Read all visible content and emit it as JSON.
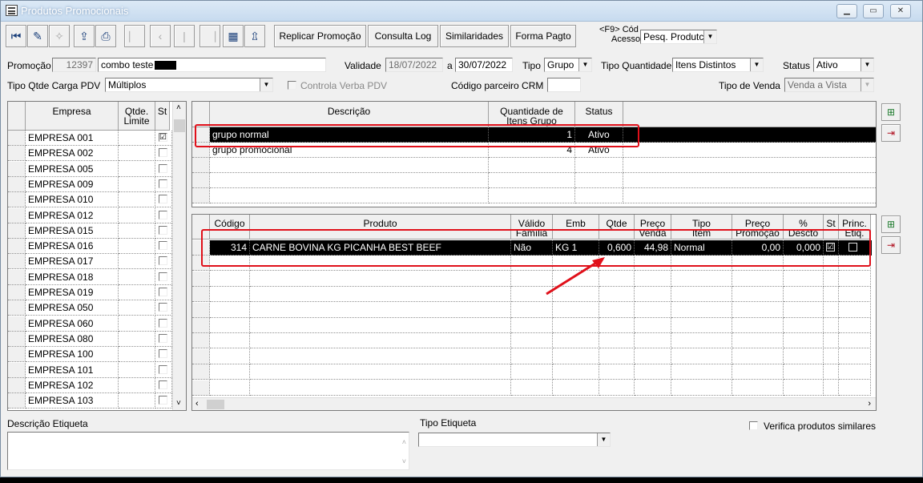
{
  "window": {
    "title": "Produtos Promocionais"
  },
  "toolbar": {
    "replicar": "Replicar Promoção",
    "consulta_log": "Consulta Log",
    "similaridades": "Similaridades",
    "forma_pagto": "Forma Pagto",
    "f9_label_1": "<F9> Cód",
    "f9_label_2": "Acesso",
    "pesq_value": "Pesq. Produtc"
  },
  "form": {
    "promocao_label": "Promoção",
    "promocao_code": "12397",
    "promocao_name": "combo teste",
    "validade_label": "Validade",
    "validade_from": "18/07/2022",
    "validade_a": "a",
    "validade_to": "30/07/2022",
    "tipo_label": "Tipo",
    "tipo_value": "Grupo",
    "tipo_qtd_label": "Tipo Quantidade",
    "tipo_qtd_value": "Itens Distintos",
    "status_label": "Status",
    "status_value": "Ativo",
    "carga_label": "Tipo Qtde Carga PDV",
    "carga_value": "Múltiplos",
    "controla_label": "Controla Verba PDV",
    "crm_label": "Código parceiro CRM",
    "crm_value": "",
    "venda_label": "Tipo de Venda",
    "venda_value": "Venda a Vista"
  },
  "empresas": {
    "headers": {
      "empresa": "Empresa",
      "qtde1": "Qtde.",
      "qtde2": "Limite",
      "st": "St"
    },
    "rows": [
      {
        "name": "EMPRESA 001",
        "checked": "☑"
      },
      {
        "name": "EMPRESA 002",
        "checked": ""
      },
      {
        "name": "EMPRESA 005",
        "checked": ""
      },
      {
        "name": "EMPRESA 009",
        "checked": ""
      },
      {
        "name": "EMPRESA 010",
        "checked": ""
      },
      {
        "name": "EMPRESA 012",
        "checked": ""
      },
      {
        "name": "EMPRESA 015",
        "checked": ""
      },
      {
        "name": "EMPRESA 016",
        "checked": ""
      },
      {
        "name": "EMPRESA 017",
        "checked": ""
      },
      {
        "name": "EMPRESA 018",
        "checked": ""
      },
      {
        "name": "EMPRESA 019",
        "checked": ""
      },
      {
        "name": "EMPRESA 050",
        "checked": ""
      },
      {
        "name": "EMPRESA 060",
        "checked": ""
      },
      {
        "name": "EMPRESA 080",
        "checked": ""
      },
      {
        "name": "EMPRESA 100",
        "checked": ""
      },
      {
        "name": "EMPRESA 101",
        "checked": ""
      },
      {
        "name": "EMPRESA 102",
        "checked": ""
      },
      {
        "name": "EMPRESA 103",
        "checked": ""
      }
    ]
  },
  "grupos": {
    "headers": {
      "descricao": "Descrição",
      "qtd1": "Quantidade de",
      "qtd2": "Itens Grupo",
      "status": "Status"
    },
    "rows": [
      {
        "descricao": "grupo normal",
        "qtd": "1",
        "status": "Ativo"
      },
      {
        "descricao": "grupo promocional",
        "qtd": "4",
        "status": "Ativo"
      }
    ]
  },
  "produtos": {
    "headers": {
      "codigo": "Código",
      "produto": "Produto",
      "valido1": "Válido",
      "valido2": "Família",
      "emb": "Emb",
      "qtde": "Qtde",
      "preco1": "Preço",
      "preco2": "Venda",
      "tipo1": "Tipo",
      "tipo2": "Item",
      "precop1": "Preço",
      "precop2": "Promoção",
      "pct1": "%",
      "pct2": "Descto",
      "st": "St",
      "princ1": "Princ.",
      "princ2": "Etiq."
    },
    "rows": [
      {
        "codigo": "314",
        "produto": "CARNE BOVINA KG PICANHA BEST BEEF",
        "valido": "Não",
        "emb": "KG  1",
        "qtde": "0,600",
        "preco": "44,98",
        "tipo": "Normal",
        "promo": "0,00",
        "descto": "0,000",
        "st": "☑"
      }
    ]
  },
  "bottom": {
    "descricao_label": "Descrição Etiqueta",
    "tipo_etiqueta_label": "Tipo Etiqueta",
    "verifica_label": "Verifica produtos similares"
  },
  "colors": {
    "highlight": "#e0101a",
    "selected_row": "#000000"
  }
}
